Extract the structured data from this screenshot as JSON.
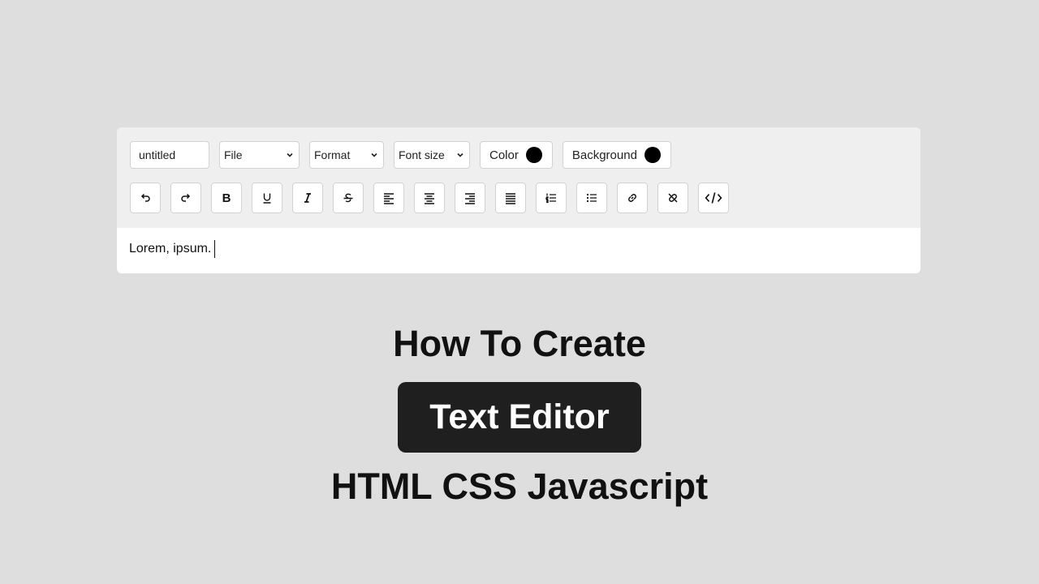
{
  "editor": {
    "title_value": "untitled",
    "file_select": "File",
    "format_select": "Format",
    "fontsize_select": "Font size",
    "color_label": "Color",
    "color_value": "#000000",
    "background_label": "Background",
    "background_value": "#000000",
    "toolbar_icons": [
      "undo-icon",
      "redo-icon",
      "bold-icon",
      "underline-icon",
      "italic-icon",
      "strikethrough-icon",
      "align-left-icon",
      "align-center-icon",
      "align-right-icon",
      "align-justify-icon",
      "ordered-list-icon",
      "unordered-list-icon",
      "link-icon",
      "unlink-icon",
      "code-icon"
    ],
    "bold_glyph": "B",
    "content_text": "Lorem, ipsum."
  },
  "headline": {
    "line1": "How To Create",
    "pill": "Text Editor",
    "line3": "HTML CSS Javascript"
  }
}
